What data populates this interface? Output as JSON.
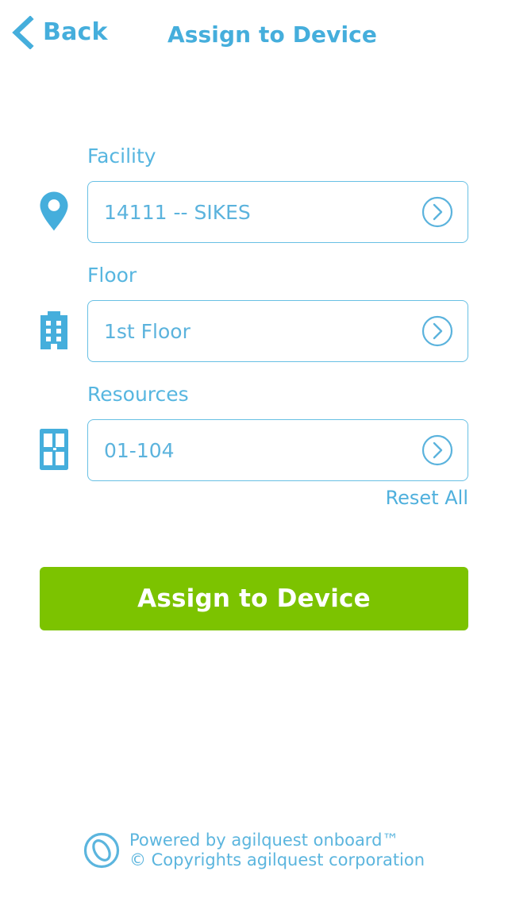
{
  "header": {
    "back_label": "Back",
    "title": "Assign to Device"
  },
  "form": {
    "fields": [
      {
        "label": "Facility",
        "value": "14111 -- SIKES",
        "icon": "map-pin-icon"
      },
      {
        "label": "Floor",
        "value": "1st Floor",
        "icon": "building-icon"
      },
      {
        "label": "Resources",
        "value": "01-104",
        "icon": "room-door-icon"
      }
    ],
    "reset_label": "Reset All"
  },
  "actions": {
    "assign_label": "Assign to Device"
  },
  "footer": {
    "line1": "Powered by agilquest onboard™",
    "line2": "© Copyrights agilquest corporation"
  },
  "colors": {
    "accent_blue": "#45aedc",
    "field_blue": "#5bb3dd",
    "border_blue": "#68c0e4",
    "action_green": "#7cc300",
    "background": "#ffffff"
  }
}
